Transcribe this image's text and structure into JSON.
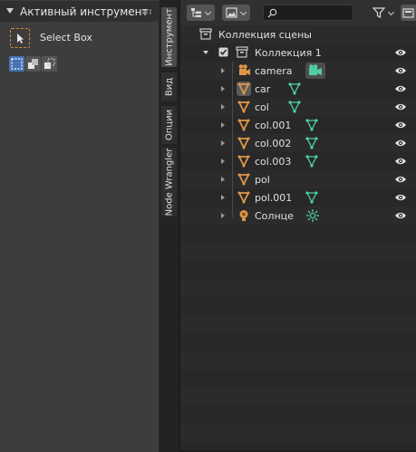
{
  "tool_panel": {
    "title": "Активный инструмент",
    "active_tool": "Select Box",
    "tool_icon": "select-box-icon",
    "selection_modes": [
      "mode-new-icon",
      "mode-extend-icon",
      "mode-subtract-icon"
    ]
  },
  "tabs": [
    {
      "label": "Инструмент",
      "active": true
    },
    {
      "label": "Вид",
      "active": false
    },
    {
      "label": "Опции",
      "active": false
    },
    {
      "label": "Node Wrangler",
      "active": false
    }
  ],
  "outliner": {
    "header": {
      "display_mode_icon": "outliner-tree-icon",
      "view_layer_icon": "image-icon",
      "search_placeholder": "",
      "filter_icon": "funnel-icon",
      "new_collection_icon": "new-collection-icon"
    },
    "scene_collection": "Коллекция сцены",
    "collection": {
      "name": "Коллекция 1",
      "checked": true
    },
    "objects": [
      {
        "name": "camera",
        "type": "camera",
        "data_icon": "camera-data-icon"
      },
      {
        "name": "car",
        "type": "mesh",
        "data_icon": "mesh-data-icon"
      },
      {
        "name": "col",
        "type": "mesh",
        "data_icon": "mesh-data-icon"
      },
      {
        "name": "col.001",
        "type": "mesh",
        "data_icon": "mesh-data-icon"
      },
      {
        "name": "col.002",
        "type": "mesh",
        "data_icon": "mesh-data-icon"
      },
      {
        "name": "col.003",
        "type": "mesh",
        "data_icon": "mesh-data-icon"
      },
      {
        "name": "pol",
        "type": "mesh",
        "data_icon": null
      },
      {
        "name": "pol.001",
        "type": "mesh",
        "data_icon": "mesh-data-icon"
      },
      {
        "name": "Солнце",
        "type": "light",
        "data_icon": "sun-light-data-icon"
      }
    ]
  },
  "colors": {
    "accent": "#4772b3",
    "object_orange": "#e0964a",
    "data_green": "#4fcfa0",
    "panel_bg": "#3d3d3d",
    "outliner_bg": "#282828"
  }
}
